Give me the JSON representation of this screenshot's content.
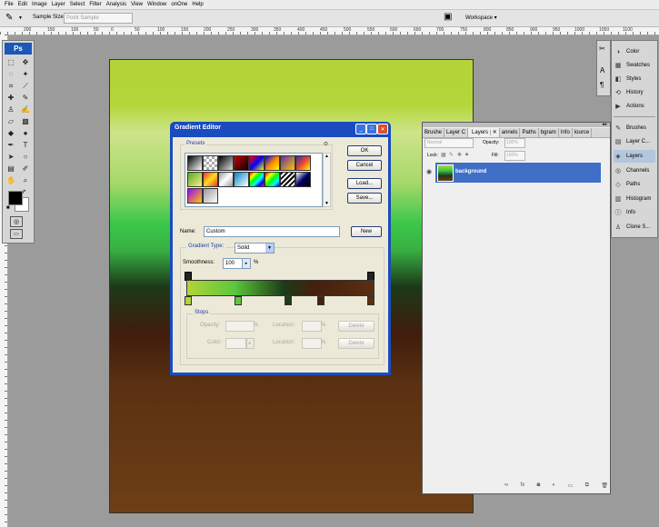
{
  "menu": [
    "File",
    "Edit",
    "Image",
    "Layer",
    "Select",
    "Filter",
    "Analysis",
    "View",
    "Window",
    "onOne",
    "Help"
  ],
  "options_bar": {
    "sample_size_label": "Sample Size:",
    "sample_size_value": "Point Sample",
    "workspace_label": "Workspace"
  },
  "ruler_top": [
    "200",
    "150",
    "100",
    "50",
    "0",
    "50",
    "100",
    "150",
    "200",
    "250",
    "300",
    "350",
    "400",
    "450",
    "500",
    "550",
    "600",
    "650",
    "700",
    "750",
    "800",
    "850",
    "900",
    "950",
    "1000",
    "1050",
    "1100"
  ],
  "toolbox": {
    "logo": "Ps"
  },
  "dock": {
    "top_items": [
      "Color",
      "Swatches",
      "Styles",
      "History",
      "Actions"
    ],
    "bottom_items": [
      "Brushes",
      "Layer C...",
      "Layers",
      "Channels",
      "Paths",
      "Histogram",
      "Info",
      "Clone S..."
    ],
    "selected": "Layers"
  },
  "layers_panel": {
    "tabs": [
      "Brushe",
      "Layer C",
      "Layers",
      "annels",
      "Paths",
      "bgram",
      "Info",
      "lource"
    ],
    "blend_mode": "Normal",
    "opacity_label": "Opacity:",
    "opacity_value": "100%",
    "lock_label": "Lock:",
    "fill_label": "Fill:",
    "fill_value": "100%",
    "layer_name": "background"
  },
  "dialog": {
    "title": "Gradient Editor",
    "presets_label": "Presets",
    "ok": "OK",
    "cancel": "Cancel",
    "load": "Load...",
    "save": "Save...",
    "name_label": "Name:",
    "name_value": "Custom",
    "new_label": "New",
    "gradient_type_label": "Gradient Type:",
    "gradient_type_value": "Solid",
    "smoothness_label": "Smoothness:",
    "smoothness_value": "100",
    "percent": "%",
    "stops_label": "Stops",
    "opacity_label": "Opacity:",
    "location_label": "Location:",
    "color_label": "Color:",
    "delete_label": "Delete"
  },
  "colors": {
    "accent": "#1a4cc0",
    "layer_selected": "#3f6fc7",
    "canvas_top": "#b3d437",
    "canvas_bottom": "#6e3f16"
  }
}
